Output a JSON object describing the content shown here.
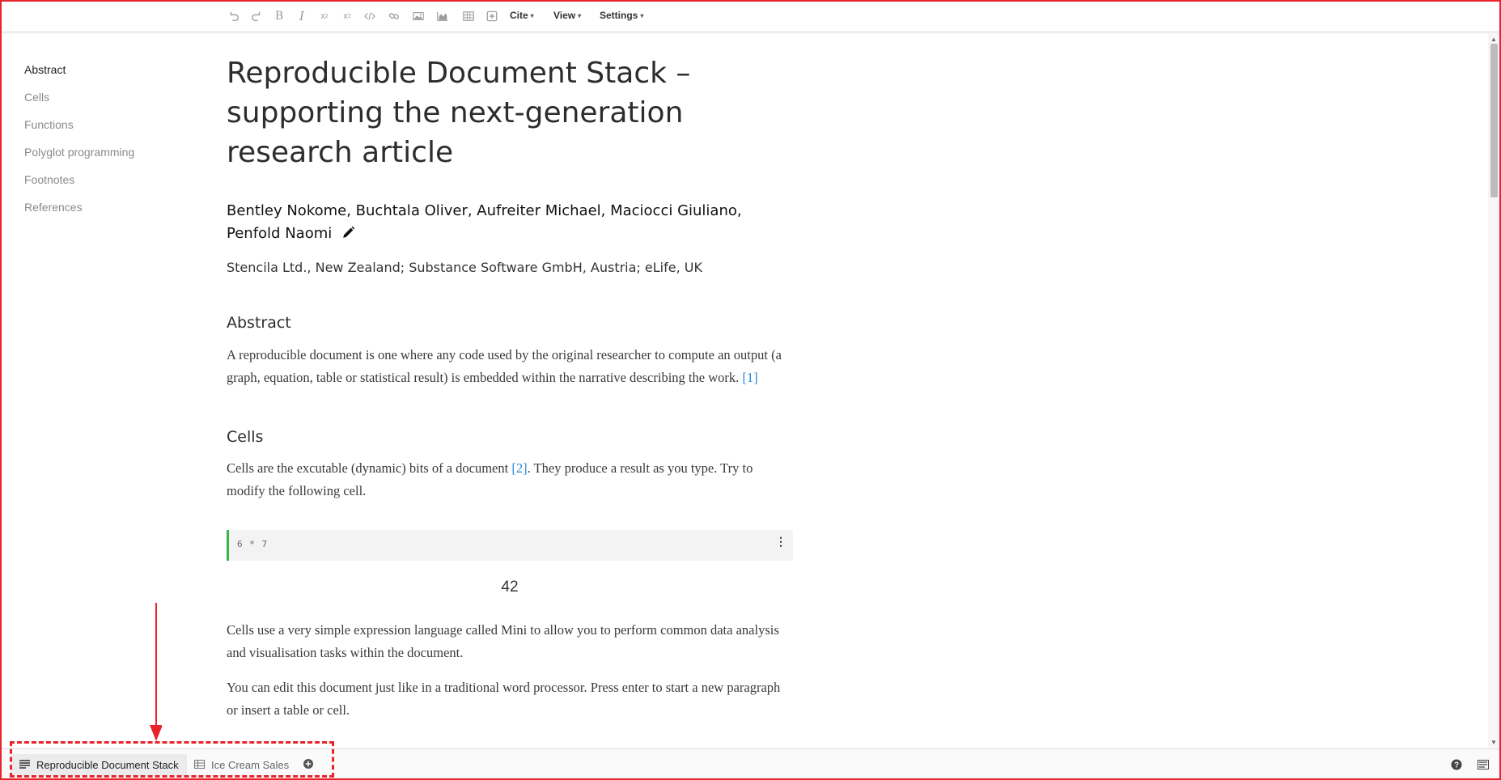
{
  "toolbar": {
    "icons": [
      "undo-icon",
      "redo-icon",
      "bold-icon",
      "italic-icon",
      "subscript-icon",
      "superscript-icon",
      "code-icon",
      "link-icon",
      "image-icon",
      "chart-icon",
      "table-icon",
      "insert-cell-icon"
    ],
    "bold_glyph": "B",
    "italic_glyph": "I",
    "cite_label": "Cite",
    "view_label": "View",
    "settings_label": "Settings"
  },
  "toc": {
    "items": [
      {
        "label": "Abstract",
        "active": true
      },
      {
        "label": "Cells",
        "active": false
      },
      {
        "label": "Functions",
        "active": false
      },
      {
        "label": "Polyglot programming",
        "active": false
      },
      {
        "label": "Footnotes",
        "active": false
      },
      {
        "label": "References",
        "active": false
      }
    ]
  },
  "document": {
    "title": "Reproducible Document Stack – supporting the next-generation research article",
    "authors": "Bentley Nokome, Buchtala Oliver, Aufreiter Michael, Maciocci Giuliano, Penfold Naomi",
    "affiliations": "Stencila Ltd., New Zealand; Substance Software GmbH, Austria; eLife, UK",
    "abstract_heading": "Abstract",
    "abstract_text": "A reproducible document is one where any code used by the original researcher to compute an output (a graph, equation, table or statistical result) is embedded within the narrative describing the work.",
    "abstract_ref": "[1]",
    "cells_heading": "Cells",
    "cells_text_1": "Cells are the excutable (dynamic) bits of a document",
    "cells_ref": "[2]",
    "cells_text_2": ". They produce a result as you type. Try to modify the following cell.",
    "cell_code": "6 * 7",
    "cell_menu": "⋮",
    "cell_output": "42",
    "para_mini": "Cells use a very simple expression language called Mini to allow you to perform common data analysis and visualisation tasks within the document.",
    "para_edit": "You can edit this document just like in a traditional word processor. Press enter to start a new paragraph or insert a table or cell."
  },
  "bottombar": {
    "tabs": [
      {
        "label": "Reproducible Document Stack",
        "icon": "document-icon",
        "active": true
      },
      {
        "label": "Ice Cream Sales",
        "icon": "sheet-icon",
        "active": false
      }
    ],
    "add_icon": "add-icon",
    "help_icon": "help-icon",
    "panel_icon": "panel-icon"
  },
  "colors": {
    "frame": "#e8232b",
    "link": "#2b8ad6",
    "cell_accent": "#3bb54a"
  }
}
